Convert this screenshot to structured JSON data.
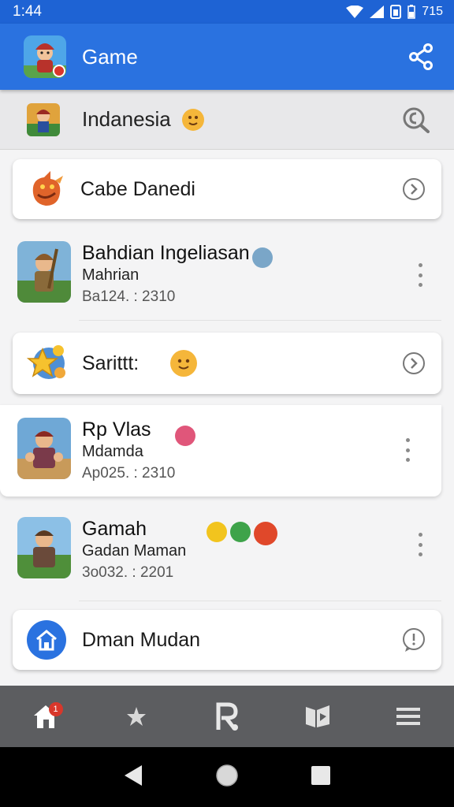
{
  "status_bar": {
    "time": "1:44",
    "battery": "715"
  },
  "app_bar": {
    "title": "Game",
    "icon": "game-character-icon",
    "action_icon": "share-icon"
  },
  "search": {
    "text": "Indanesia",
    "icon": "search-icon"
  },
  "items": [
    {
      "kind": "card",
      "label": "Cabe Danedi",
      "icon": "dragon-icon",
      "right_icon": "chevron-right-circle-icon"
    },
    {
      "kind": "row",
      "title": "Bahdian Ingeliasan",
      "subtitle": "Mahrian",
      "meta": "Ba124. : 2310",
      "icon": "warrior-icon"
    },
    {
      "kind": "card",
      "label": "Sarittt:",
      "icon": "star-icon",
      "right_icon": "chevron-right-circle-icon"
    },
    {
      "kind": "row",
      "title": "Rp Vlas",
      "subtitle": "Mdamda",
      "meta": "Ap025. : 2310",
      "icon": "fighter-icon"
    },
    {
      "kind": "row",
      "title": "Gamah",
      "subtitle": "Gadan Maman",
      "meta": "3o032. : 2201",
      "icon": "ranger-icon"
    },
    {
      "kind": "card",
      "label": "Dman Mudan",
      "icon": "home-icon",
      "right_icon": "chat-bubble-icon"
    }
  ],
  "bottom_nav": {
    "items": [
      {
        "name": "home",
        "icon": "home-icon",
        "badge": "1"
      },
      {
        "name": "favorites",
        "icon": "star-icon"
      },
      {
        "name": "profile",
        "icon": "r-icon"
      },
      {
        "name": "library",
        "icon": "book-icon"
      },
      {
        "name": "menu",
        "icon": "menu-icon"
      }
    ]
  },
  "colors": {
    "primary": "#2a72e0",
    "status_bar": "#1e63d4",
    "nav_bar": "#5c5d60",
    "badge": "#d8372b"
  }
}
